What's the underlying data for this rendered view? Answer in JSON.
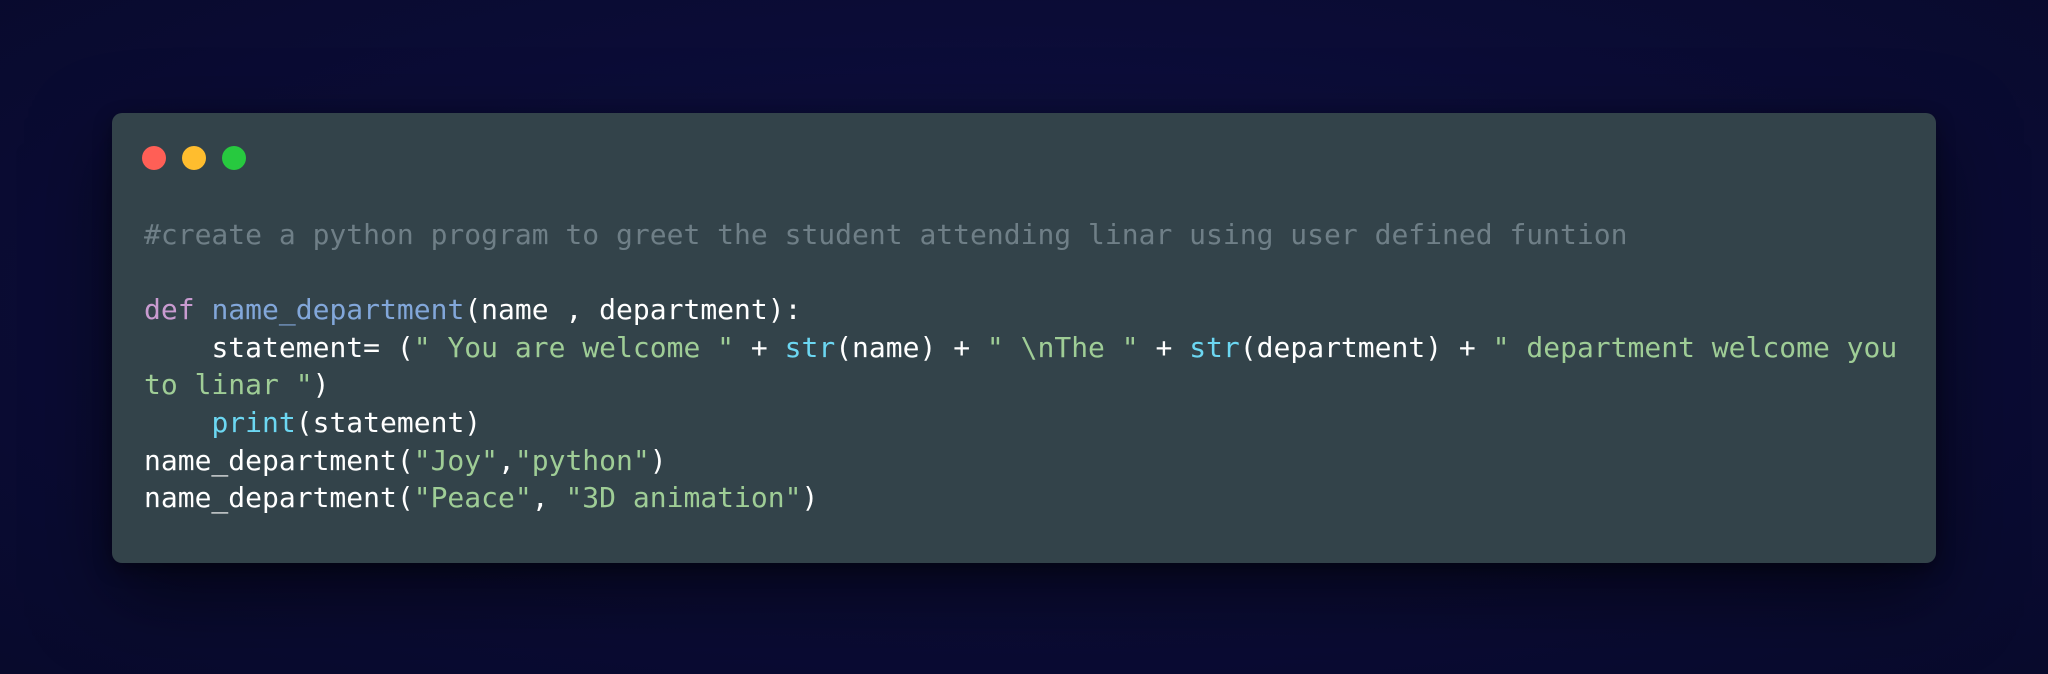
{
  "window": {
    "controls": [
      "close",
      "minimize",
      "maximize"
    ],
    "colors": {
      "background": "#33434a",
      "page_background": "#0b0c36",
      "close": "#ff5f56",
      "minimize": "#ffbd2e",
      "maximize": "#27c93f"
    }
  },
  "code": {
    "language": "python",
    "syntax_colors": {
      "comment": "#6f7f87",
      "keyword": "#c99bd0",
      "function": "#82a7da",
      "builtin": "#6cd7f2",
      "string": "#9fcd96",
      "plain": "#ffffff"
    },
    "lines": [
      {
        "tokens": [
          {
            "t": "comment",
            "v": "#create a python program to greet the student attending linar using user defined funtion"
          }
        ]
      },
      {
        "tokens": []
      },
      {
        "tokens": [
          {
            "t": "keyword",
            "v": "def"
          },
          {
            "t": "plain",
            "v": " "
          },
          {
            "t": "fn",
            "v": "name_department"
          },
          {
            "t": "plain",
            "v": "(name , department):"
          }
        ]
      },
      {
        "tokens": [
          {
            "t": "plain",
            "v": "    statement= ("
          },
          {
            "t": "string",
            "v": "\" You are welcome \""
          },
          {
            "t": "plain",
            "v": " + "
          },
          {
            "t": "builtin",
            "v": "str"
          },
          {
            "t": "plain",
            "v": "(name) + "
          },
          {
            "t": "string",
            "v": "\" \\nThe \""
          },
          {
            "t": "plain",
            "v": " + "
          },
          {
            "t": "builtin",
            "v": "str"
          },
          {
            "t": "plain",
            "v": "(department) + "
          },
          {
            "t": "string",
            "v": "\" department welcome you to linar \""
          },
          {
            "t": "plain",
            "v": ")"
          }
        ]
      },
      {
        "tokens": [
          {
            "t": "plain",
            "v": "    "
          },
          {
            "t": "builtin",
            "v": "print"
          },
          {
            "t": "plain",
            "v": "(statement)"
          }
        ]
      },
      {
        "tokens": [
          {
            "t": "plain",
            "v": "name_department("
          },
          {
            "t": "string",
            "v": "\"Joy\""
          },
          {
            "t": "plain",
            "v": ","
          },
          {
            "t": "string",
            "v": "\"python\""
          },
          {
            "t": "plain",
            "v": ")"
          }
        ]
      },
      {
        "tokens": [
          {
            "t": "plain",
            "v": "name_department("
          },
          {
            "t": "string",
            "v": "\"Peace\""
          },
          {
            "t": "plain",
            "v": ", "
          },
          {
            "t": "string",
            "v": "\"3D animation\""
          },
          {
            "t": "plain",
            "v": ")"
          }
        ]
      }
    ]
  }
}
